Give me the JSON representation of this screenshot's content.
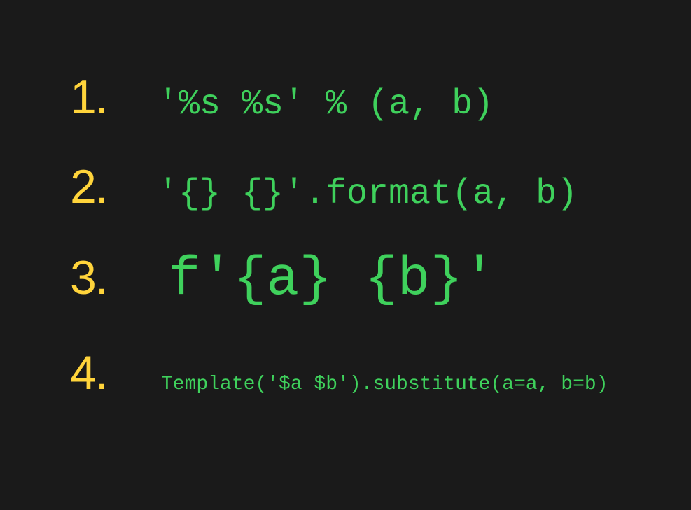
{
  "items": [
    {
      "number": "1.",
      "code": "'%s %s' % (a, b)"
    },
    {
      "number": "2.",
      "code": "'{} {}'.format(a, b)"
    },
    {
      "number": "3.",
      "code": "f'{a} {b}'"
    },
    {
      "number": "4.",
      "code": "Template('$a $b').substitute(a=a, b=b)"
    }
  ]
}
